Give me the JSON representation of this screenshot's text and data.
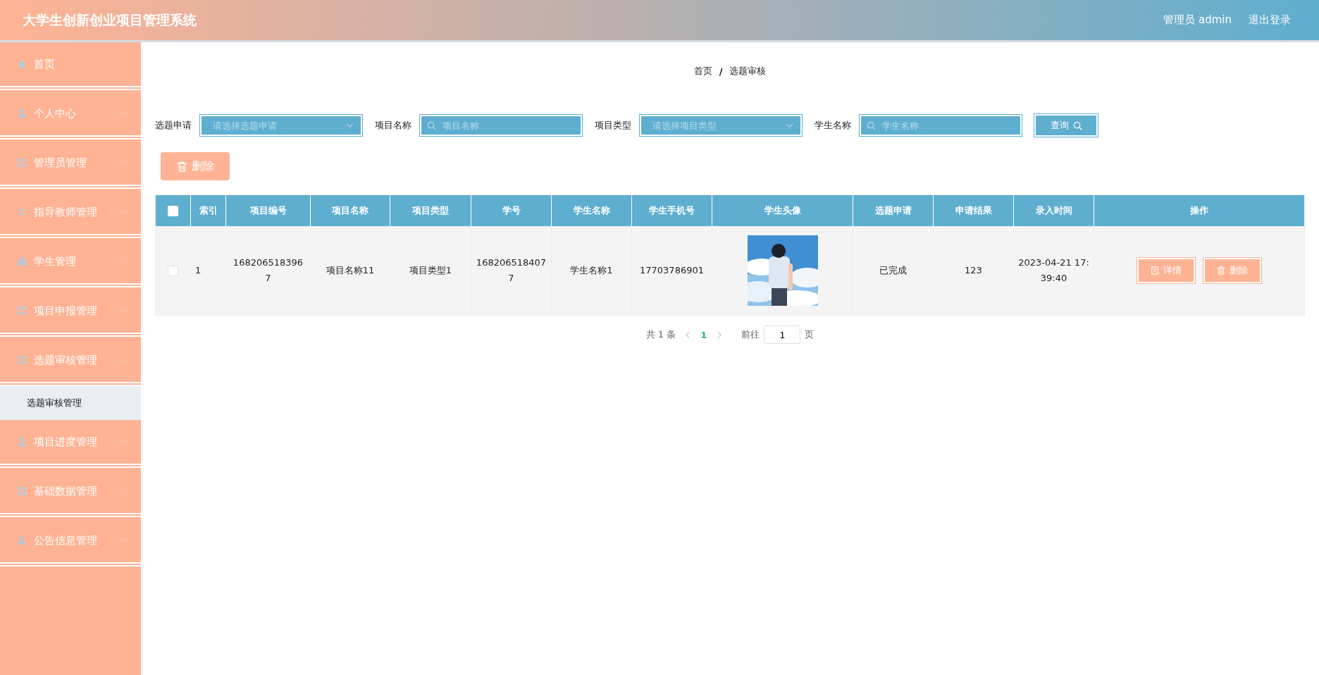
{
  "header": {
    "title": "大学生创新创业项目管理系统",
    "user": "管理员 admin",
    "logout": "退出登录"
  },
  "sidebar": {
    "items": [
      {
        "label": "首页",
        "expandable": false
      },
      {
        "label": "个人中心",
        "expandable": true,
        "expanded": false
      },
      {
        "label": "管理员管理",
        "expandable": true,
        "expanded": false
      },
      {
        "label": "指导教师管理",
        "expandable": true,
        "expanded": false
      },
      {
        "label": "学生管理",
        "expandable": true,
        "expanded": false
      },
      {
        "label": "项目申报管理",
        "expandable": true,
        "expanded": false
      },
      {
        "label": "选题审核管理",
        "expandable": true,
        "expanded": true,
        "children": [
          {
            "label": "选题审核管理",
            "selected": true
          }
        ]
      },
      {
        "label": "项目进度管理",
        "expandable": true,
        "expanded": false
      },
      {
        "label": "基础数据管理",
        "expandable": true,
        "expanded": false
      },
      {
        "label": "公告信息管理",
        "expandable": true,
        "expanded": false
      }
    ]
  },
  "breadcrumb": [
    "首页",
    "选题审核"
  ],
  "breadcrumb_separator": "/",
  "filters": [
    {
      "label": "选题申请",
      "kind": "select",
      "placeholder": "请选择选题申请"
    },
    {
      "label": "项目名称",
      "kind": "input",
      "placeholder": "项目名称"
    },
    {
      "label": "项目类型",
      "kind": "select",
      "placeholder": "请选择项目类型"
    },
    {
      "label": "学生名称",
      "kind": "input",
      "placeholder": "学生名称"
    }
  ],
  "search_button": "查询",
  "delete_button": "删除",
  "table": {
    "all_checked": false,
    "columns": [
      "索引",
      "项目编号",
      "项目名称",
      "项目类型",
      "学号",
      "学生名称",
      "学生手机号",
      "学生头像",
      "选题申请",
      "申请结果",
      "录入时间",
      "操作"
    ],
    "rows": [
      {
        "checked": false,
        "cells": [
          "1",
          "1682065183967",
          "项目名称11",
          "项目类型1",
          "1682065184077",
          "学生名称1",
          "17703786901"
        ],
        "avatar": {
          "kind": "picture"
        },
        "cells_after": [
          "已完成",
          "123",
          "2023-04-21 17:39:40"
        ],
        "actions": [
          "详情",
          "删除"
        ]
      }
    ]
  },
  "pagination": {
    "total": "共 1 条",
    "pages": [
      {
        "label": "1",
        "selected": true
      }
    ],
    "goto": "前往",
    "page_input": "1",
    "page_suffix": "页"
  }
}
